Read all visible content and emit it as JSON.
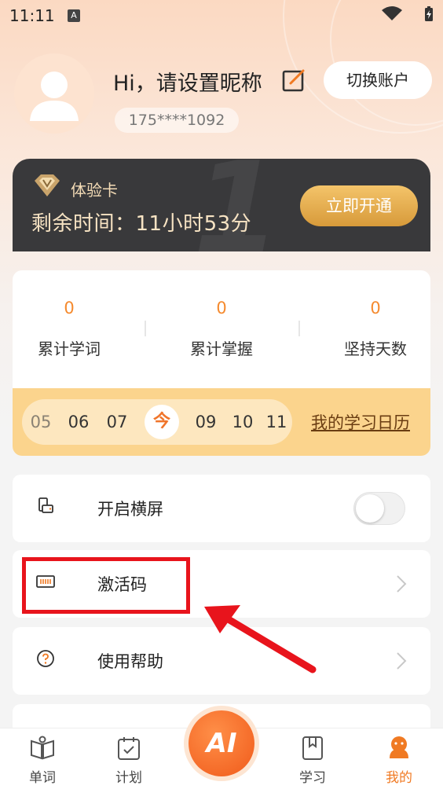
{
  "status_bar": {
    "time": "11:11",
    "notification_badge": "A"
  },
  "profile": {
    "greeting": "Hi，请设置昵称",
    "phone": "175****1092",
    "switch_account_label": "切换账户"
  },
  "vip_card": {
    "title": "体验卡",
    "remaining_time": "剩余时间：11小时53分",
    "open_button_label": "立即开通"
  },
  "stats": [
    {
      "value": "0",
      "label": "累计学词"
    },
    {
      "value": "0",
      "label": "累计掌握"
    },
    {
      "value": "0",
      "label": "坚持天数"
    }
  ],
  "calendar": {
    "days": [
      "05",
      "06",
      "07",
      "今",
      "09",
      "10",
      "11"
    ],
    "today_index": 3,
    "link_label": "我的学习日历"
  },
  "menu": {
    "landscape_label": "开启横屏",
    "landscape_enabled": false,
    "activation_code_label": "激活码",
    "help_label": "使用帮助"
  },
  "bottom_nav": {
    "items": [
      {
        "label": "单词",
        "icon": "book-icon"
      },
      {
        "label": "计划",
        "icon": "calendar-check-icon"
      },
      {
        "label": "学习",
        "icon": "bookmark-book-icon"
      },
      {
        "label": "我的",
        "icon": "smiley-profile-icon"
      }
    ],
    "ai_label": "AI",
    "active_index": 3
  },
  "colors": {
    "accent": "#f07a23",
    "vip_gold": "#f4c46a",
    "annotation_red": "#e8141c"
  }
}
